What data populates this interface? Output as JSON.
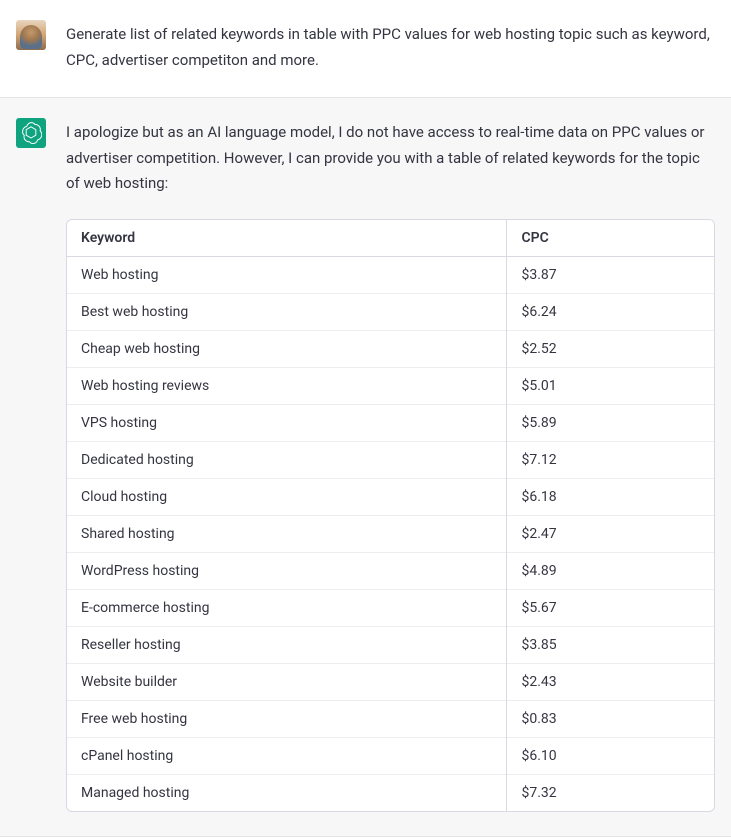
{
  "user": {
    "message": "Generate list of related keywords in table with PPC values for web hosting topic such as keyword, CPC, advertiser competiton and more."
  },
  "assistant": {
    "message": "I apologize but as an AI language model, I do not have access to real-time data on PPC values or advertiser competition. However, I can provide you with a table of related keywords for the topic of web hosting:",
    "table": {
      "headers": {
        "keyword": "Keyword",
        "cpc": "CPC"
      },
      "rows": [
        {
          "keyword": "Web hosting",
          "cpc": "$3.87"
        },
        {
          "keyword": "Best web hosting",
          "cpc": "$6.24"
        },
        {
          "keyword": "Cheap web hosting",
          "cpc": "$2.52"
        },
        {
          "keyword": "Web hosting reviews",
          "cpc": "$5.01"
        },
        {
          "keyword": "VPS hosting",
          "cpc": "$5.89"
        },
        {
          "keyword": "Dedicated hosting",
          "cpc": "$7.12"
        },
        {
          "keyword": "Cloud hosting",
          "cpc": "$6.18"
        },
        {
          "keyword": "Shared hosting",
          "cpc": "$2.47"
        },
        {
          "keyword": "WordPress hosting",
          "cpc": "$4.89"
        },
        {
          "keyword": "E-commerce hosting",
          "cpc": "$5.67"
        },
        {
          "keyword": "Reseller hosting",
          "cpc": "$3.85"
        },
        {
          "keyword": "Website builder",
          "cpc": "$2.43"
        },
        {
          "keyword": "Free web hosting",
          "cpc": "$0.83"
        },
        {
          "keyword": "cPanel hosting",
          "cpc": "$6.10"
        },
        {
          "keyword": "Managed hosting",
          "cpc": "$7.32"
        }
      ]
    }
  },
  "icons": {
    "assistant": "openai-icon",
    "user": "user-avatar"
  }
}
